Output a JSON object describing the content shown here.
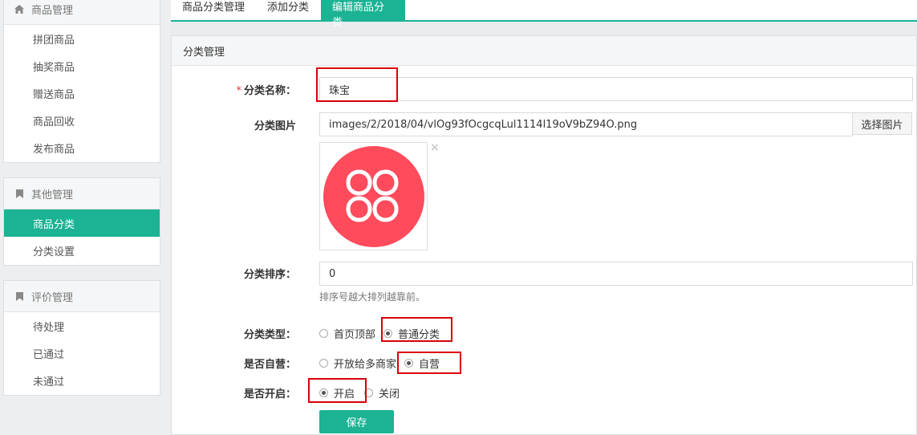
{
  "sidebar": {
    "groups": [
      {
        "title": "商品管理",
        "icon": "home-icon",
        "items": [
          "拼团商品",
          "抽奖商品",
          "赠送商品",
          "商品回收",
          "发布商品"
        ]
      },
      {
        "title": "其他管理",
        "icon": "bookmark-icon",
        "items": [
          "商品分类",
          "分类设置"
        ],
        "active": "商品分类"
      },
      {
        "title": "评价管理",
        "icon": "bookmark-icon",
        "items": [
          "待处理",
          "已通过",
          "未通过"
        ]
      }
    ]
  },
  "tabs": [
    {
      "label": "商品分类管理",
      "active": false
    },
    {
      "label": "添加分类",
      "active": false
    },
    {
      "label": "编辑商品分类",
      "active": true
    }
  ],
  "panel_title": "分类管理",
  "form": {
    "name_label": "分类名称：",
    "name_required": "*",
    "name_value": "珠宝",
    "image_label": "分类图片",
    "image_value": "images/2/2018/04/vlOg93fOcgcqLul1114l19oV9bZ94O.png",
    "image_button": "选择图片",
    "image_close": "×",
    "sort_label": "分类排序：",
    "sort_value": "0",
    "sort_help": "排序号越大排列越靠前。",
    "type_label": "分类类型：",
    "type_options": [
      "首页顶部",
      "普通分类"
    ],
    "type_selected": "普通分类",
    "self_label": "是否自营：",
    "self_options": [
      "开放给多商家",
      "自营"
    ],
    "self_selected": "自营",
    "enable_label": "是否开启：",
    "enable_options": [
      "开启",
      "关闭"
    ],
    "enable_selected": "开启",
    "save_label": "保存"
  },
  "colors": {
    "accent": "#1bb394",
    "highlight": "#d9000d",
    "thumb_bg": "#ff4b5c"
  }
}
